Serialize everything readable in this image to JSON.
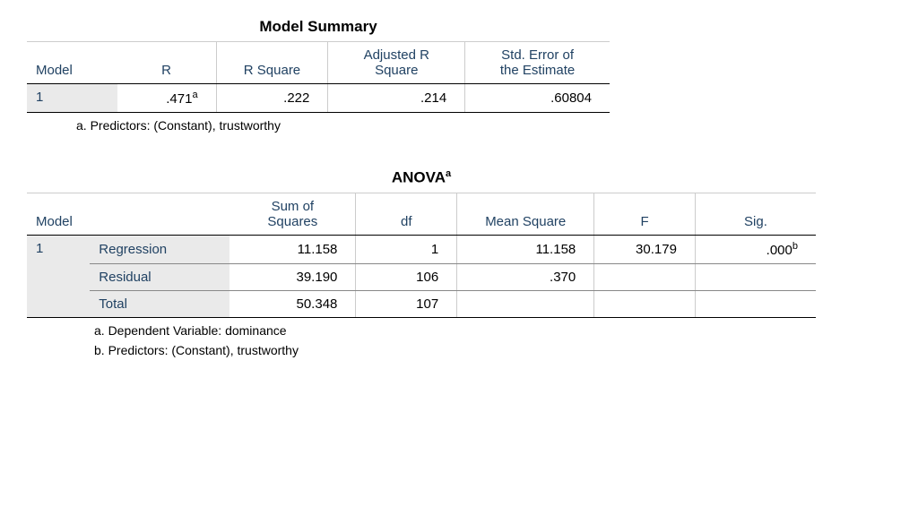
{
  "model_summary": {
    "title": "Model Summary",
    "headers": {
      "model": "Model",
      "r": "R",
      "r_square": "R Square",
      "adj_r_square": "Adjusted R\nSquare",
      "std_error": "Std. Error of\nthe Estimate"
    },
    "row": {
      "model": "1",
      "r": ".471",
      "r_sup": "a",
      "r_square": ".222",
      "adj_r_square": ".214",
      "std_error": ".60804"
    },
    "footnote_a": "a. Predictors: (Constant), trustworthy"
  },
  "anova": {
    "title": "ANOVA",
    "title_sup": "a",
    "headers": {
      "model": "Model",
      "sum_sq": "Sum of\nSquares",
      "df": "df",
      "mean_sq": "Mean Square",
      "f": "F",
      "sig": "Sig."
    },
    "model_num": "1",
    "rows": {
      "regression": {
        "label": "Regression",
        "sum_sq": "11.158",
        "df": "1",
        "mean_sq": "11.158",
        "f": "30.179",
        "sig": ".000",
        "sig_sup": "b"
      },
      "residual": {
        "label": "Residual",
        "sum_sq": "39.190",
        "df": "106",
        "mean_sq": ".370",
        "f": "",
        "sig": ""
      },
      "total": {
        "label": "Total",
        "sum_sq": "50.348",
        "df": "107",
        "mean_sq": "",
        "f": "",
        "sig": ""
      }
    },
    "footnote_a": "a. Dependent Variable: dominance",
    "footnote_b": "b. Predictors: (Constant), trustworthy"
  }
}
